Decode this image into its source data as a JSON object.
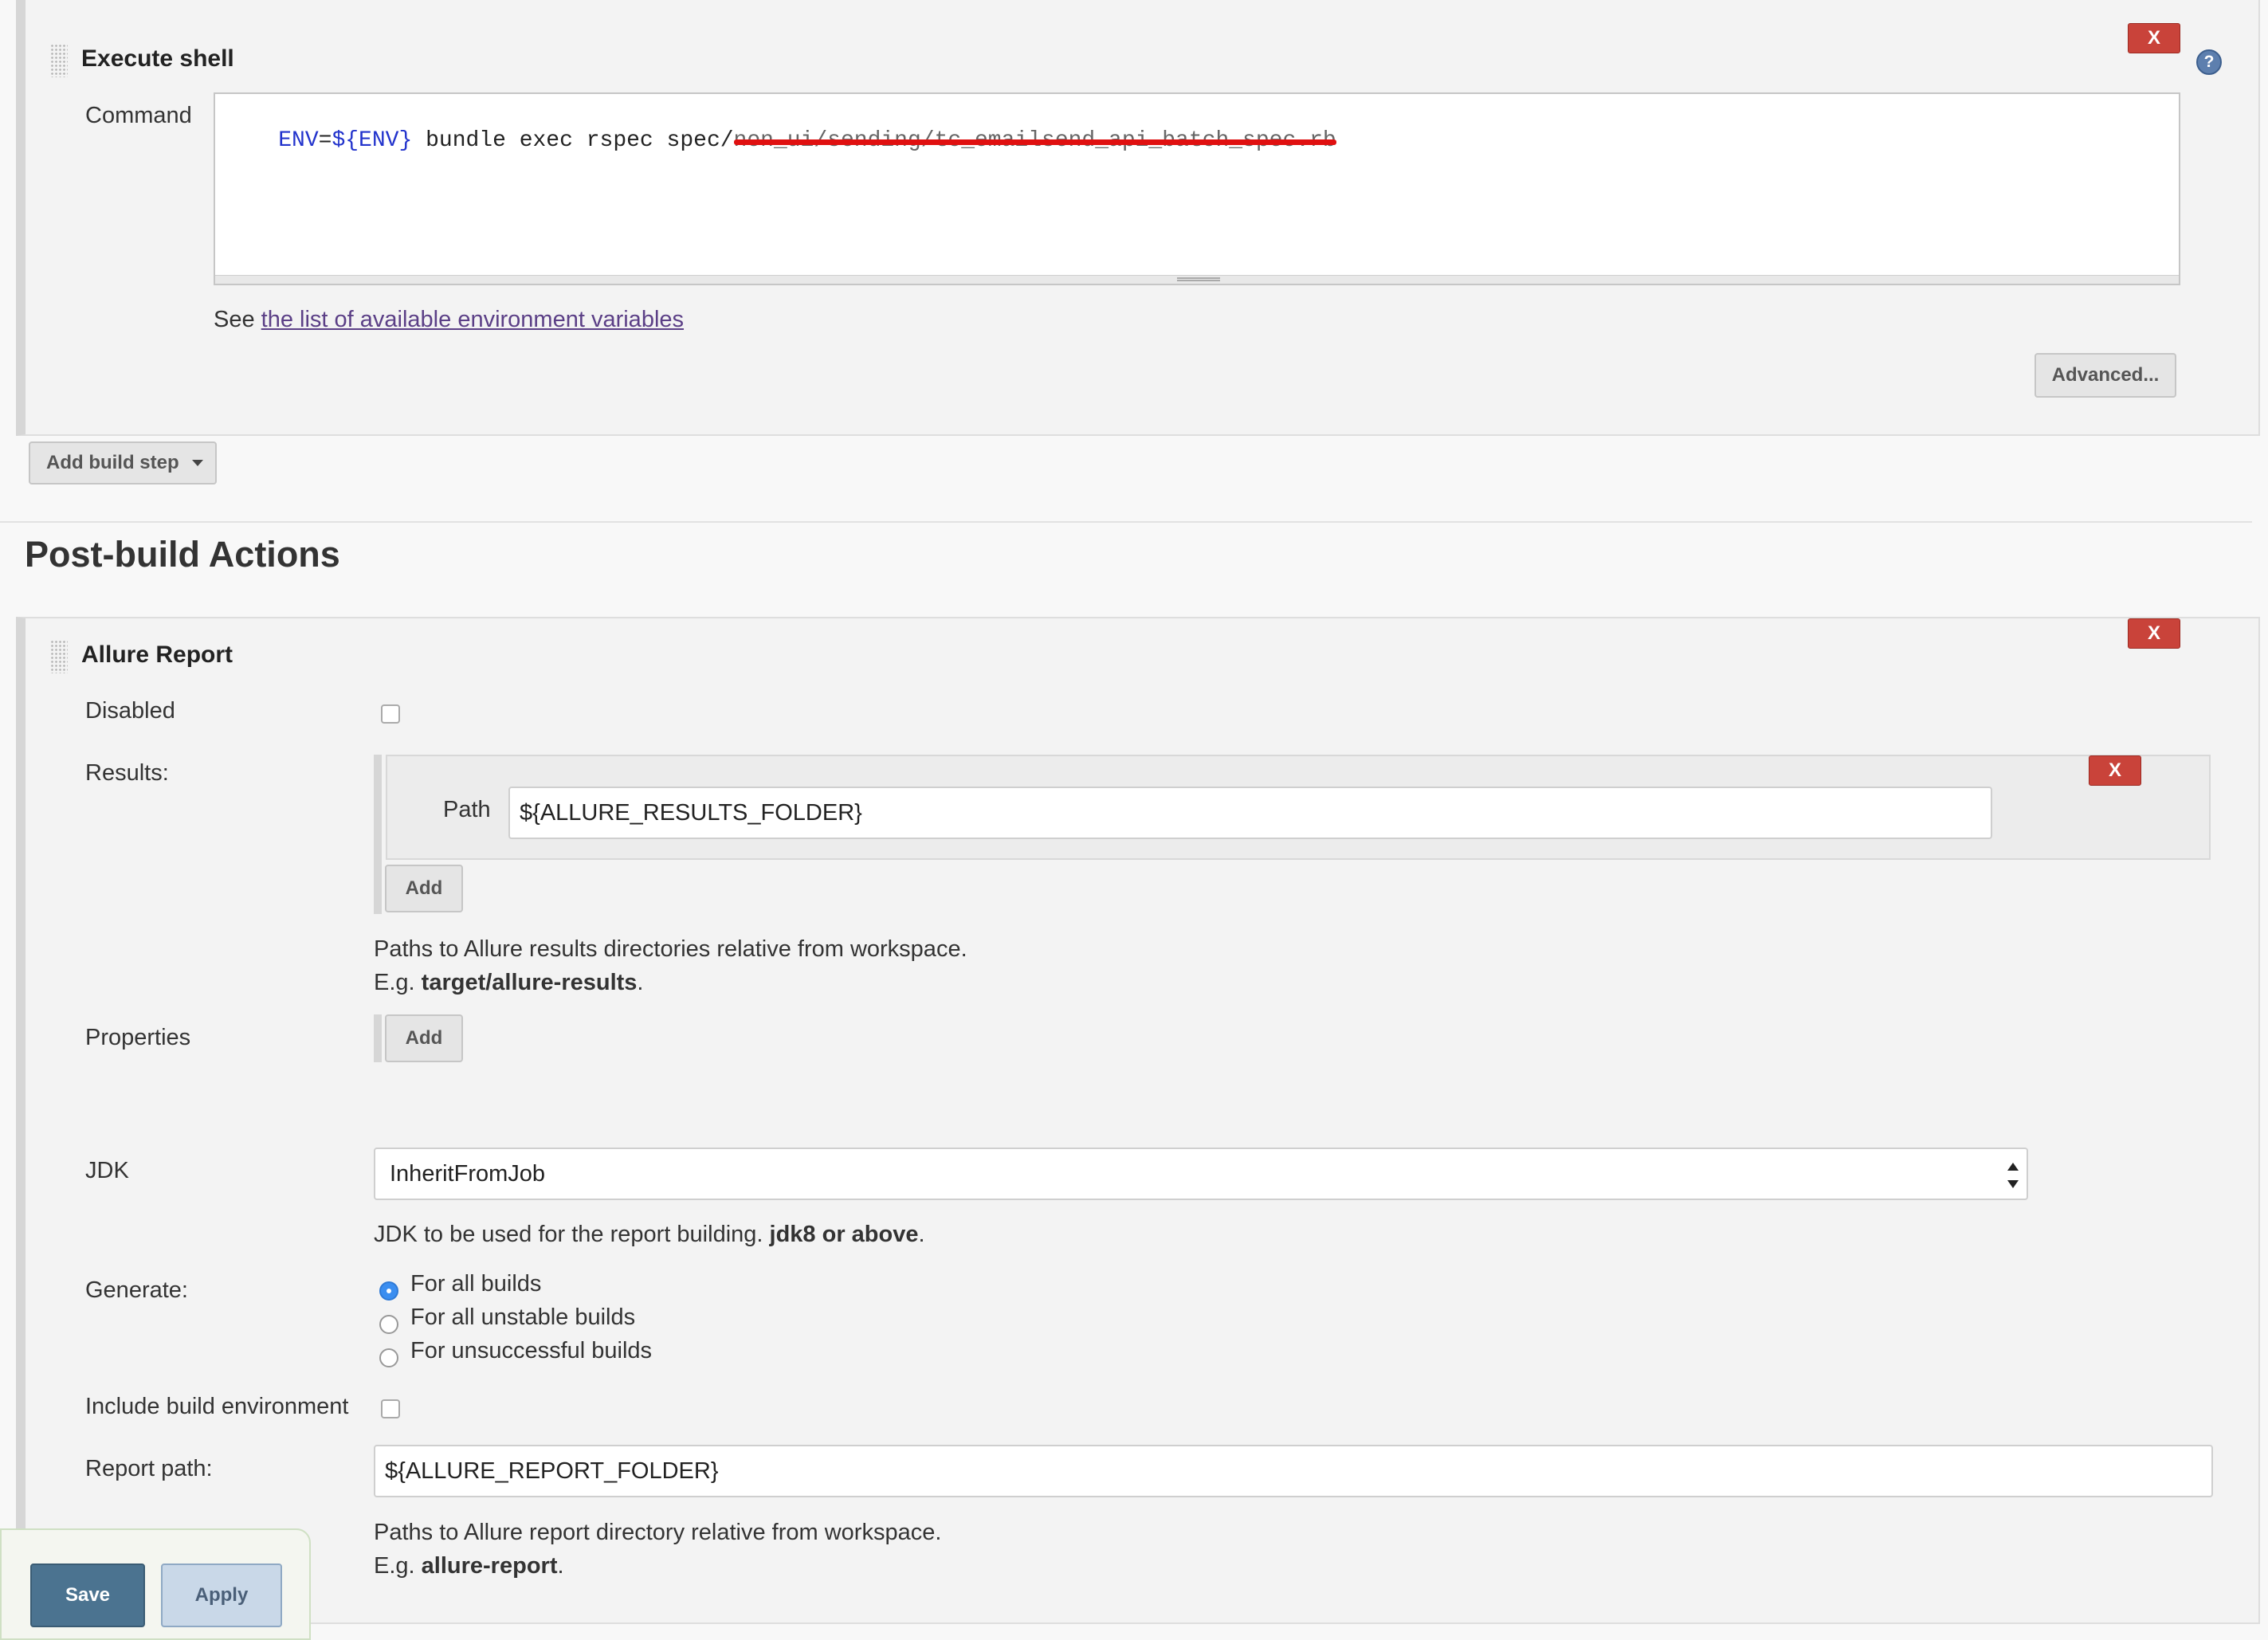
{
  "execute_shell": {
    "title": "Execute shell",
    "command_label": "Command",
    "command": {
      "env_key": "ENV",
      "equals": "=",
      "env_var": "${ENV}",
      "rest": " bundle exec rspec spec/",
      "redacted": "non_ui/sending/tc_emailsend_api_batch_spec.rb"
    },
    "see_prefix": "See ",
    "env_vars_link": "the list of available environment variables",
    "advanced_label": "Advanced...",
    "delete_label": "X",
    "help_label": "?"
  },
  "add_build_step": {
    "label": "Add build step"
  },
  "post_build": {
    "heading": "Post-build Actions",
    "allure": {
      "title": "Allure Report",
      "delete_label": "X",
      "disabled_label": "Disabled",
      "disabled_checked": false,
      "results_label": "Results:",
      "path_label": "Path",
      "path_value": "${ALLURE_RESULTS_FOLDER}",
      "path_delete_label": "X",
      "add_label": "Add",
      "results_help_line1": "Paths to Allure results directories relative from workspace.",
      "results_help_eg": "E.g. ",
      "results_help_example": "target/allure-results",
      "results_help_end": ".",
      "properties_label": "Properties",
      "properties_add_label": "Add",
      "jdk_label": "JDK",
      "jdk_value": "InheritFromJob",
      "jdk_help_prefix": "JDK to be used for the report building. ",
      "jdk_help_bold": "jdk8 or above",
      "jdk_help_end": ".",
      "generate_label": "Generate:",
      "generate_options": [
        "For all builds",
        "For all unstable builds",
        "For unsuccessful builds"
      ],
      "generate_selected": 0,
      "include_env_label": "Include build environment",
      "include_env_checked": false,
      "report_path_label": "Report path:",
      "report_path_value": "${ALLURE_REPORT_FOLDER}",
      "report_help_line1": "Paths to Allure report directory relative from workspace.",
      "report_help_eg": "E.g. ",
      "report_help_example": "allure-report",
      "report_help_end": "."
    }
  },
  "footer": {
    "save_label": "Save",
    "apply_label": "Apply"
  },
  "colors": {
    "delete_red": "#c9433a",
    "link_purple": "#5b3f86",
    "env_blue": "#2233cc",
    "redaction_red": "#e01010",
    "save_bg": "#4b7390",
    "apply_bg": "#c9d8e8"
  }
}
